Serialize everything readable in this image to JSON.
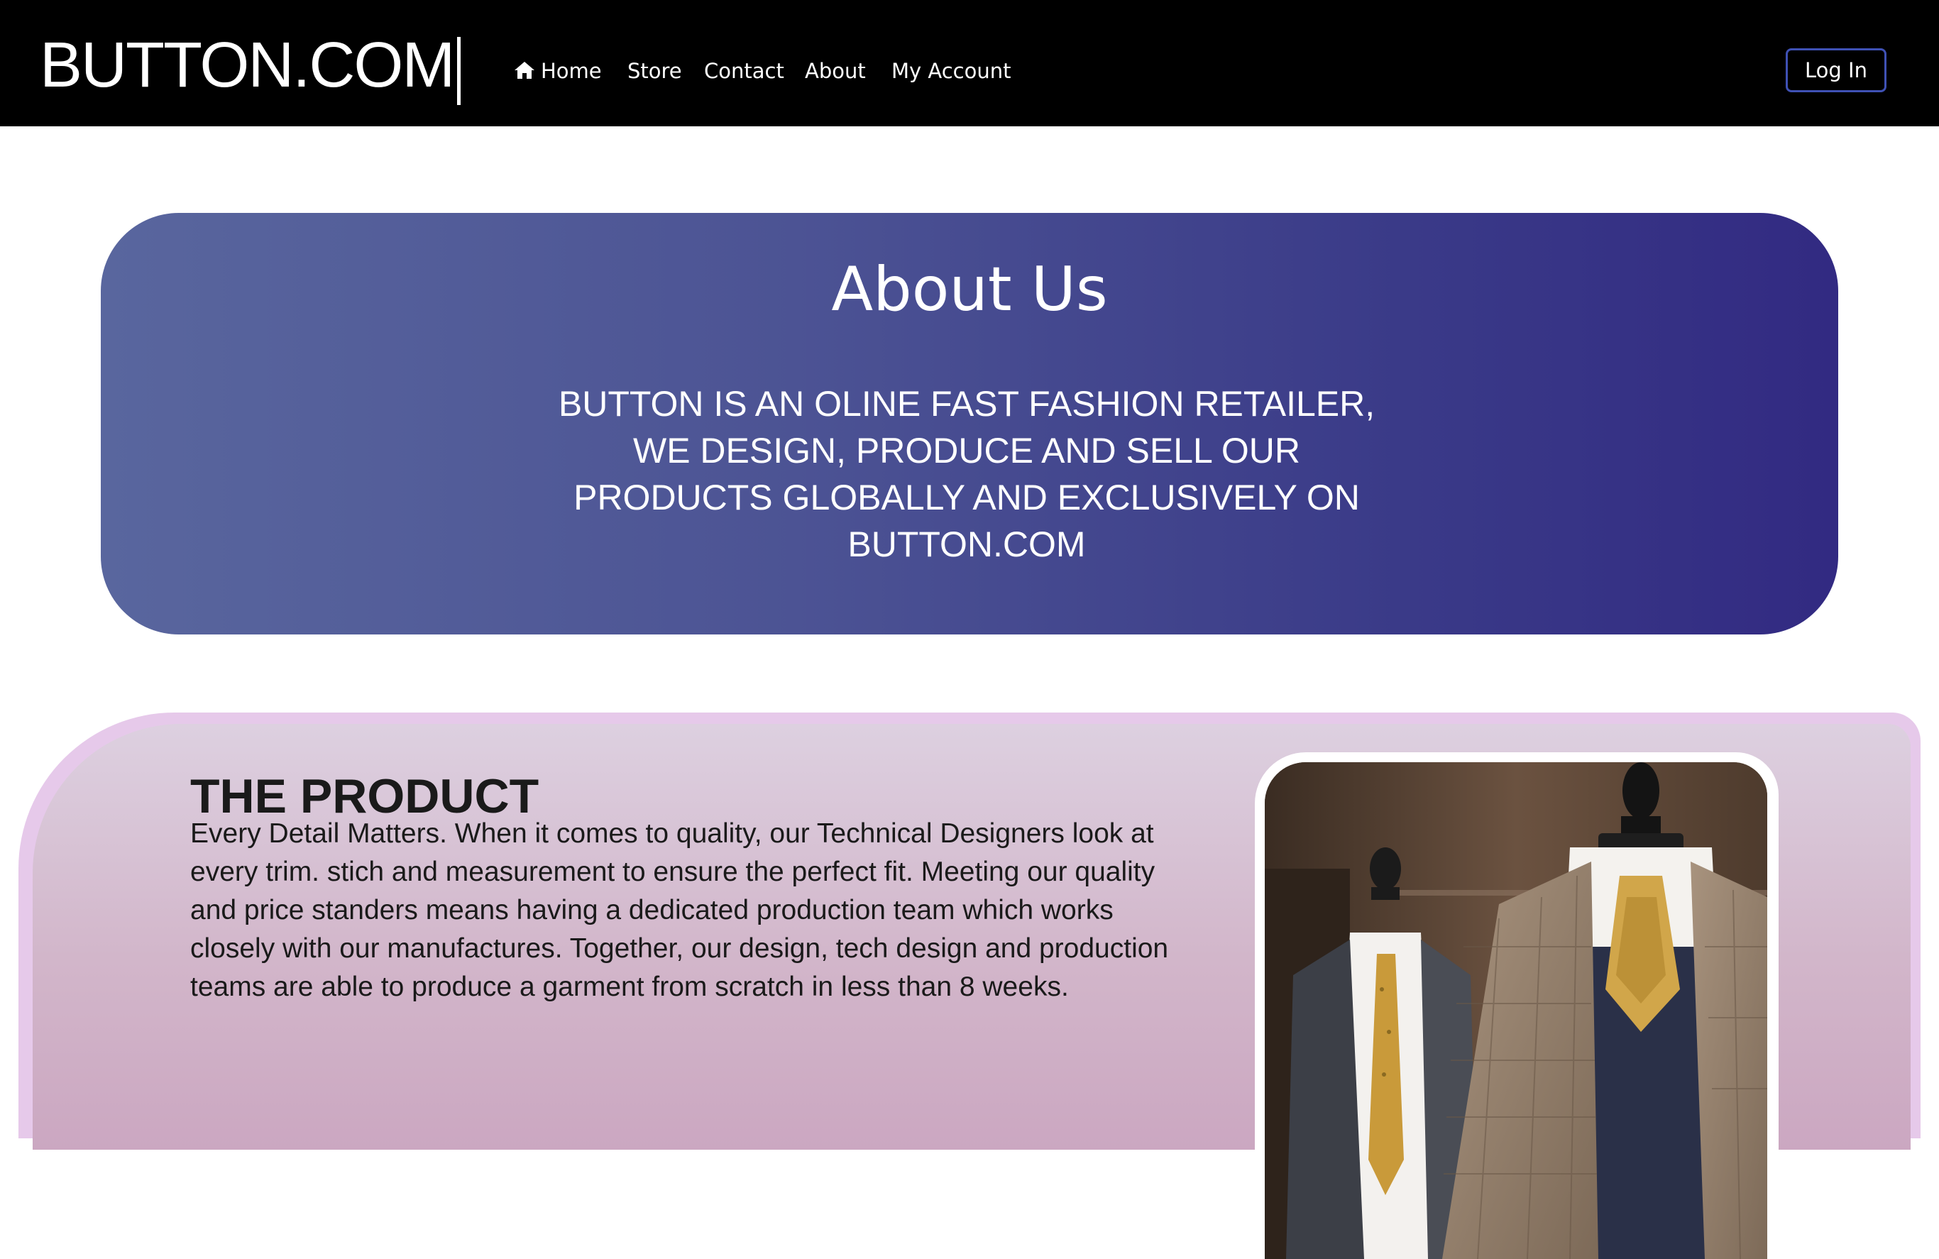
{
  "nav": {
    "brand": "BUTTON.COM",
    "links": [
      {
        "label": "Home",
        "icon": "home-icon"
      },
      {
        "label": "Store"
      },
      {
        "label": "Contact"
      },
      {
        "label": "About"
      },
      {
        "label": "My Account"
      }
    ],
    "login_label": "Log In"
  },
  "about": {
    "title": "About Us",
    "text": "BUTTON IS AN OLINE FAST FASHION RETAILER, WE DESIGN, PRODUCE AND SELL OUR PRODUCTS GLOBALLY AND EXCLUSIVELY ON BUTTON.COM"
  },
  "product": {
    "title": "THE PRODUCT",
    "text": "Every Detail Matters. When it comes to quality, our Technical Designers look at every trim. stich and measurement  to ensure the perfect fit. Meeting our quality and price standers means having a dedicated production team which works closely with our manufactures. Together,  our design, tech design and production teams are able to produce a garment from scratch in less than 8 weeks.",
    "image": "suit-mannequins-photo"
  },
  "colors": {
    "navbar_bg": "#000000",
    "login_border": "#3f51b5",
    "about_gradient_start": "#59669e",
    "about_gradient_end": "#322a82",
    "product_border": "#e6c9ea",
    "product_bg": "#d2b6ca"
  }
}
